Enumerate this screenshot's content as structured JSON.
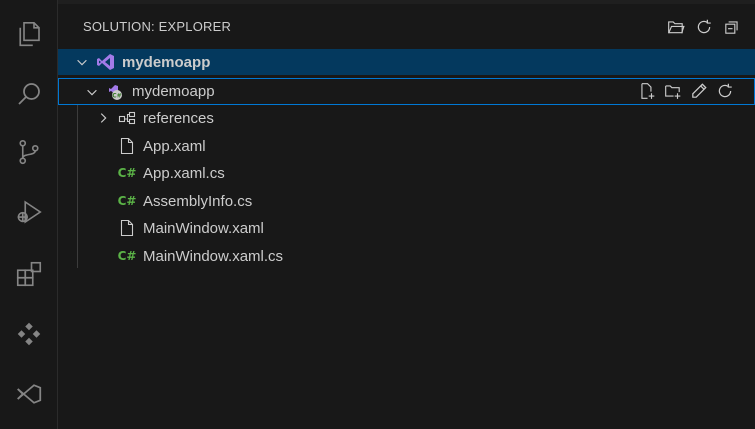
{
  "sidebar": {
    "title": "SOLUTION: EXPLORER",
    "header_actions": [
      "open-folder-icon",
      "refresh-icon",
      "collapse-all-icon"
    ]
  },
  "tree": {
    "solution": {
      "label": "mydemoapp",
      "icon": "visual-studio-icon",
      "expanded": true
    },
    "project": {
      "label": "mydemoapp",
      "icon": "csharp-project-icon",
      "expanded": true,
      "actions": [
        "new-file-icon",
        "new-folder-icon",
        "rename-icon",
        "refresh-icon"
      ]
    },
    "items": [
      {
        "label": "references",
        "icon": "references-icon",
        "collapsible": true
      },
      {
        "label": "App.xaml",
        "icon": "file-icon"
      },
      {
        "label": "App.xaml.cs",
        "icon": "csharp-file-icon",
        "glyph": "C#"
      },
      {
        "label": "AssemblyInfo.cs",
        "icon": "csharp-file-icon",
        "glyph": "C#"
      },
      {
        "label": "MainWindow.xaml",
        "icon": "file-icon"
      },
      {
        "label": "MainWindow.xaml.cs",
        "icon": "csharp-file-icon",
        "glyph": "C#"
      }
    ]
  },
  "activity_bar": [
    "explorer-icon",
    "search-icon",
    "source-control-icon",
    "run-debug-icon",
    "extensions-icon",
    "copilot-icon",
    "visual-studio-icon"
  ],
  "colors": {
    "selected_row": "#04395e",
    "focus_border": "#0078d4",
    "csharp_green": "#5bb347",
    "vs_purple": "#a27ae8"
  }
}
